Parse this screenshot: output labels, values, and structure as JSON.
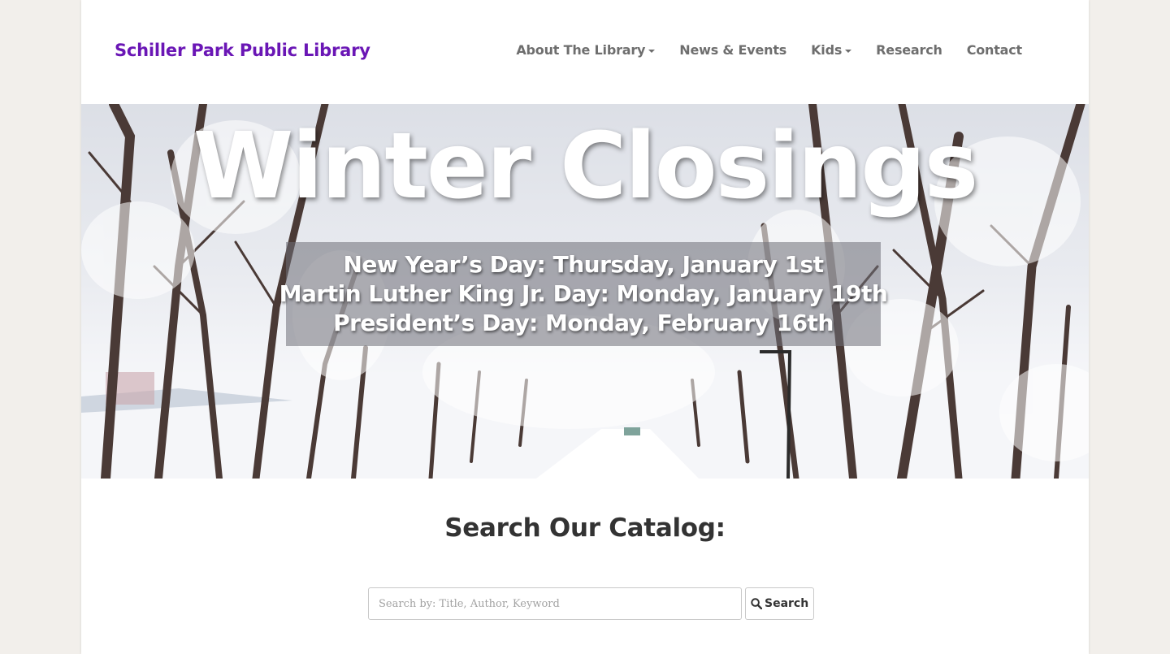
{
  "header": {
    "brand": "Schiller Park Public Library",
    "nav": [
      {
        "label": "About The Library",
        "dropdown": true
      },
      {
        "label": "News & Events",
        "dropdown": false
      },
      {
        "label": "Kids",
        "dropdown": true
      },
      {
        "label": "Research",
        "dropdown": false
      },
      {
        "label": "Contact",
        "dropdown": false
      }
    ]
  },
  "hero": {
    "title": "Winter Closings",
    "closings": [
      "New Year’s Day: Thursday, January 1st",
      "Martin Luther King Jr. Day: Monday, January 19th",
      "President’s Day: Monday, February 16th"
    ]
  },
  "catalog": {
    "heading": "Search Our Catalog:",
    "search_placeholder": "Search by: Title, Author, Keyword",
    "search_value": "",
    "search_button": "Search",
    "search_icon": "magnifier-icon"
  },
  "colors": {
    "brand": "#6a16b5",
    "nav_text": "#6e6e6e",
    "page_background": "#f2efeb",
    "heading_text": "#333333"
  }
}
